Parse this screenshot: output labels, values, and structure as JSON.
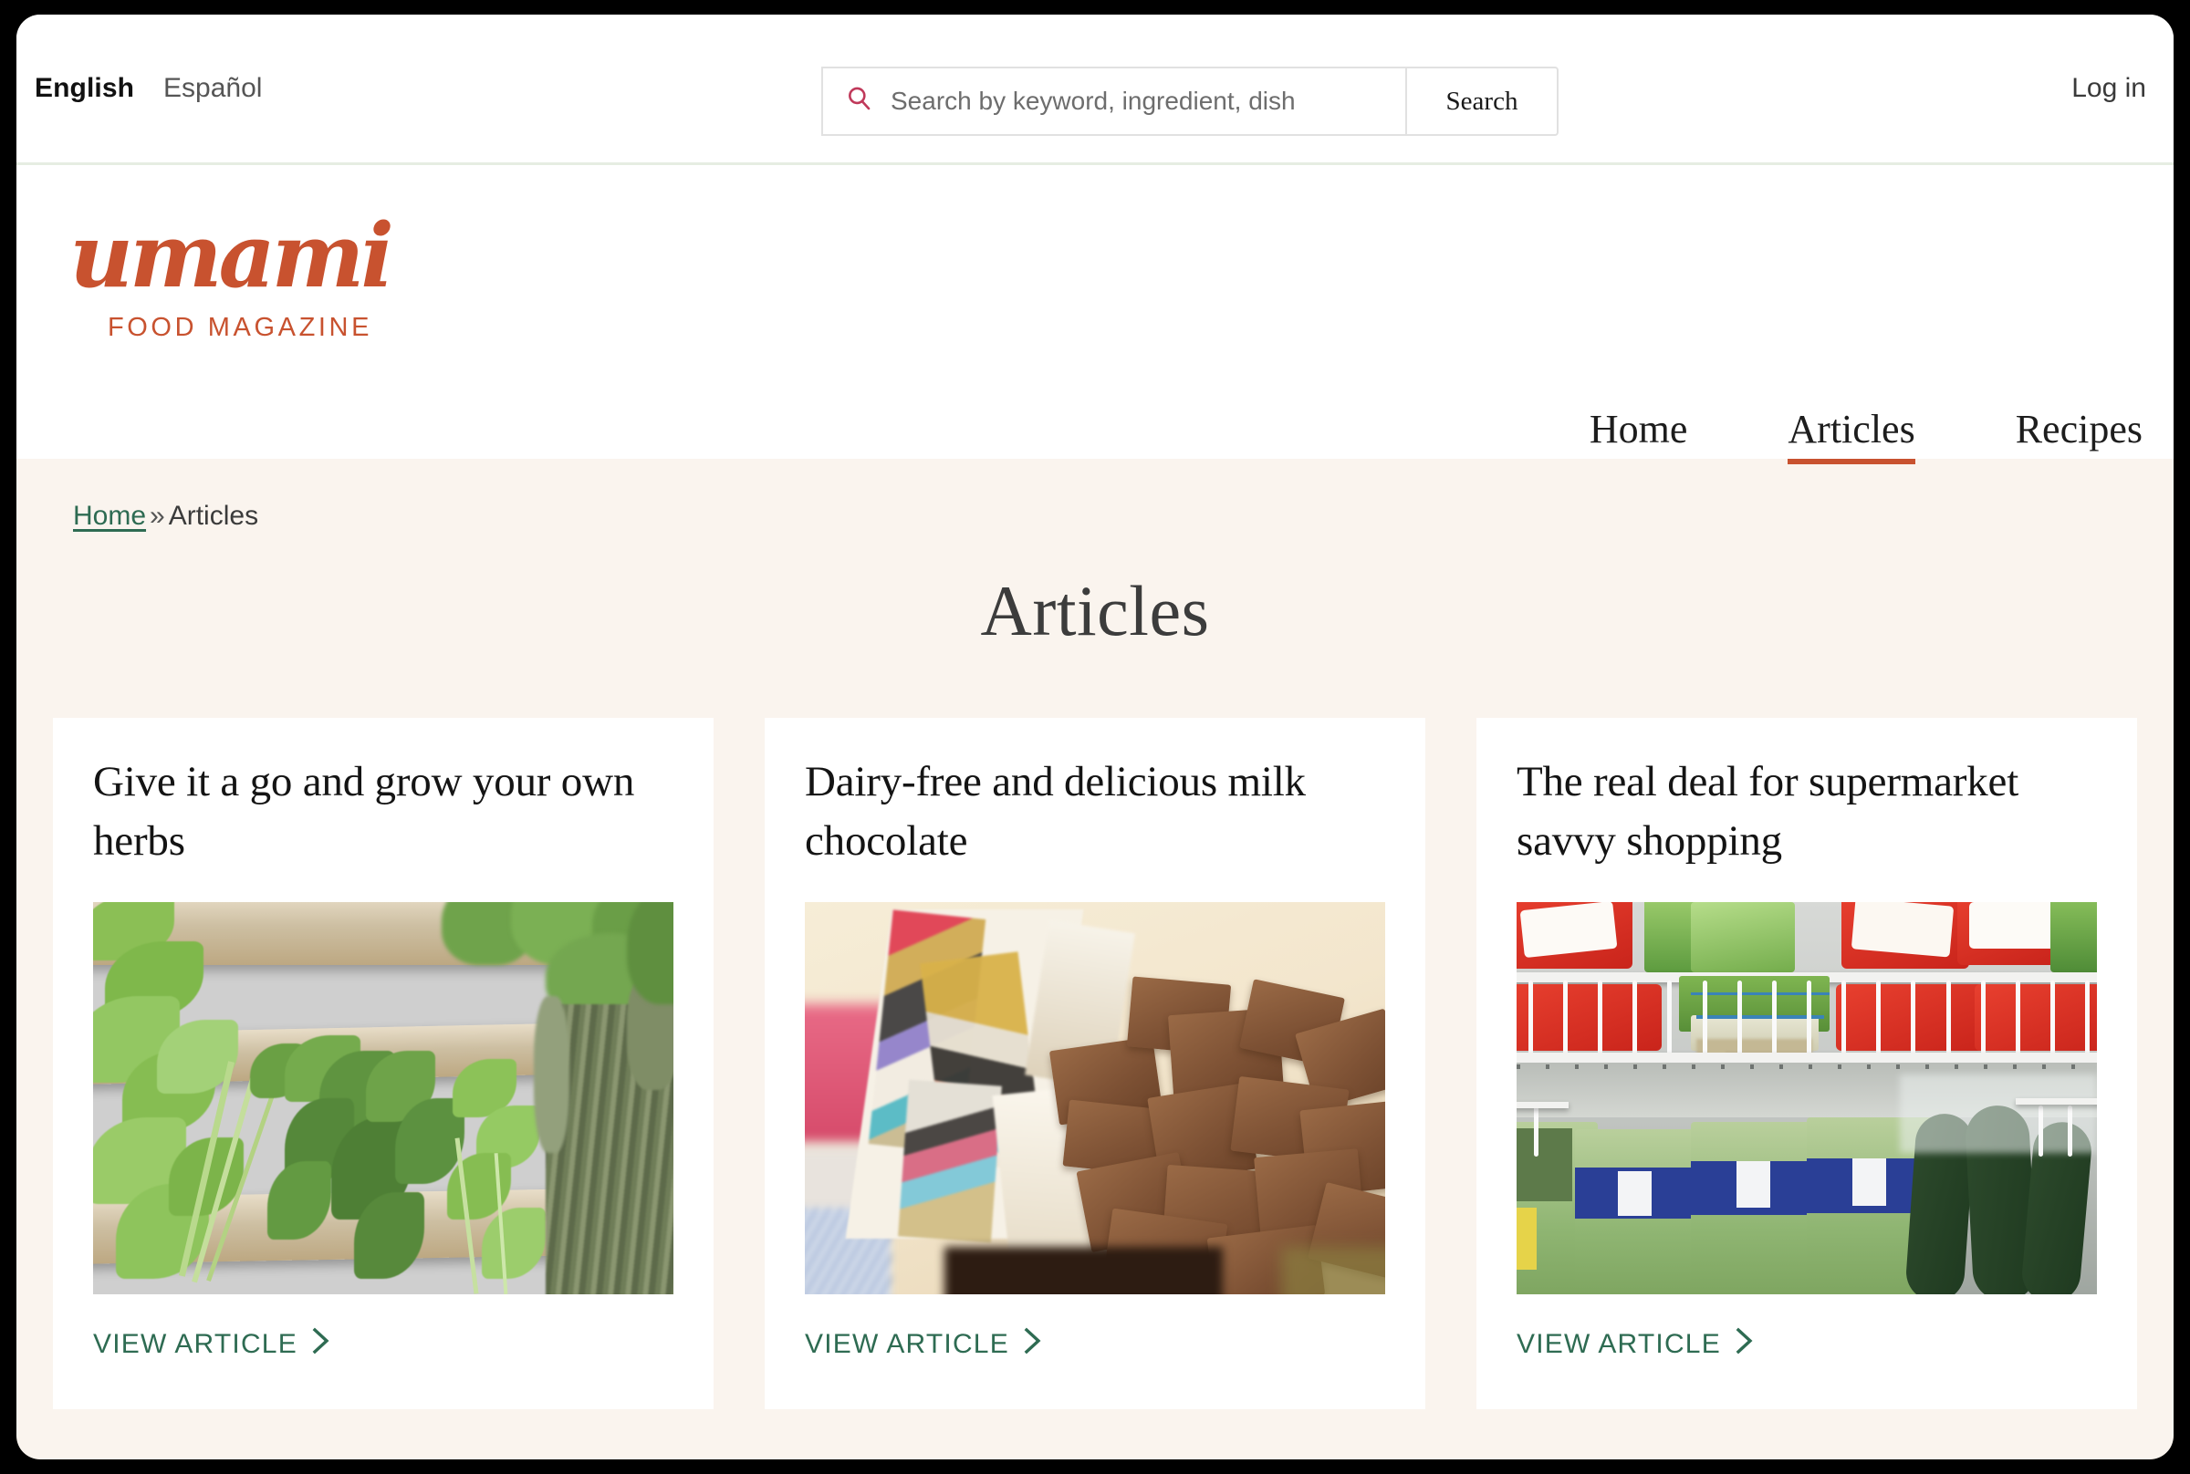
{
  "utility_bar": {
    "language_active": "English",
    "language_alt": "Español",
    "search_placeholder": "Search by keyword, ingredient, dish",
    "search_value": "",
    "search_button_label": "Search",
    "login_label": "Log in",
    "search_icon": "magnifier-icon"
  },
  "brand": {
    "wordmark": "umami",
    "tagline": "FOOD MAGAZINE",
    "color": "#C8522F"
  },
  "nav": {
    "items": [
      {
        "label": "Home",
        "active": false
      },
      {
        "label": "Articles",
        "active": true
      },
      {
        "label": "Recipes",
        "active": false
      }
    ],
    "active_underline_color": "#C8522F"
  },
  "breadcrumb": {
    "home_label": "Home",
    "separator": "»",
    "current_label": "Articles",
    "link_color": "#2E6B52"
  },
  "page": {
    "title": "Articles",
    "background_color": "#FAF4EE"
  },
  "cards": [
    {
      "title": "Give it a go and grow your own herbs",
      "cta_label": "VIEW ARTICLE",
      "cta_icon": "chevron-right-icon",
      "image_alt": "fresh herbs parsley mint coriander thyme dill on wooden slats"
    },
    {
      "title": "Dairy-free and delicious milk chocolate",
      "cta_label": "VIEW ARTICLE",
      "cta_icon": "chevron-right-icon",
      "image_alt": "chunks of milk chocolate spilling out of a patterned wrapper"
    },
    {
      "title": "The real deal for supermarket savvy shopping",
      "cta_label": "VIEW ARTICLE",
      "cta_icon": "chevron-right-icon",
      "image_alt": "supermarket chilled shelf with red bagged produce, spring onions and packaged rocket salad"
    }
  ]
}
